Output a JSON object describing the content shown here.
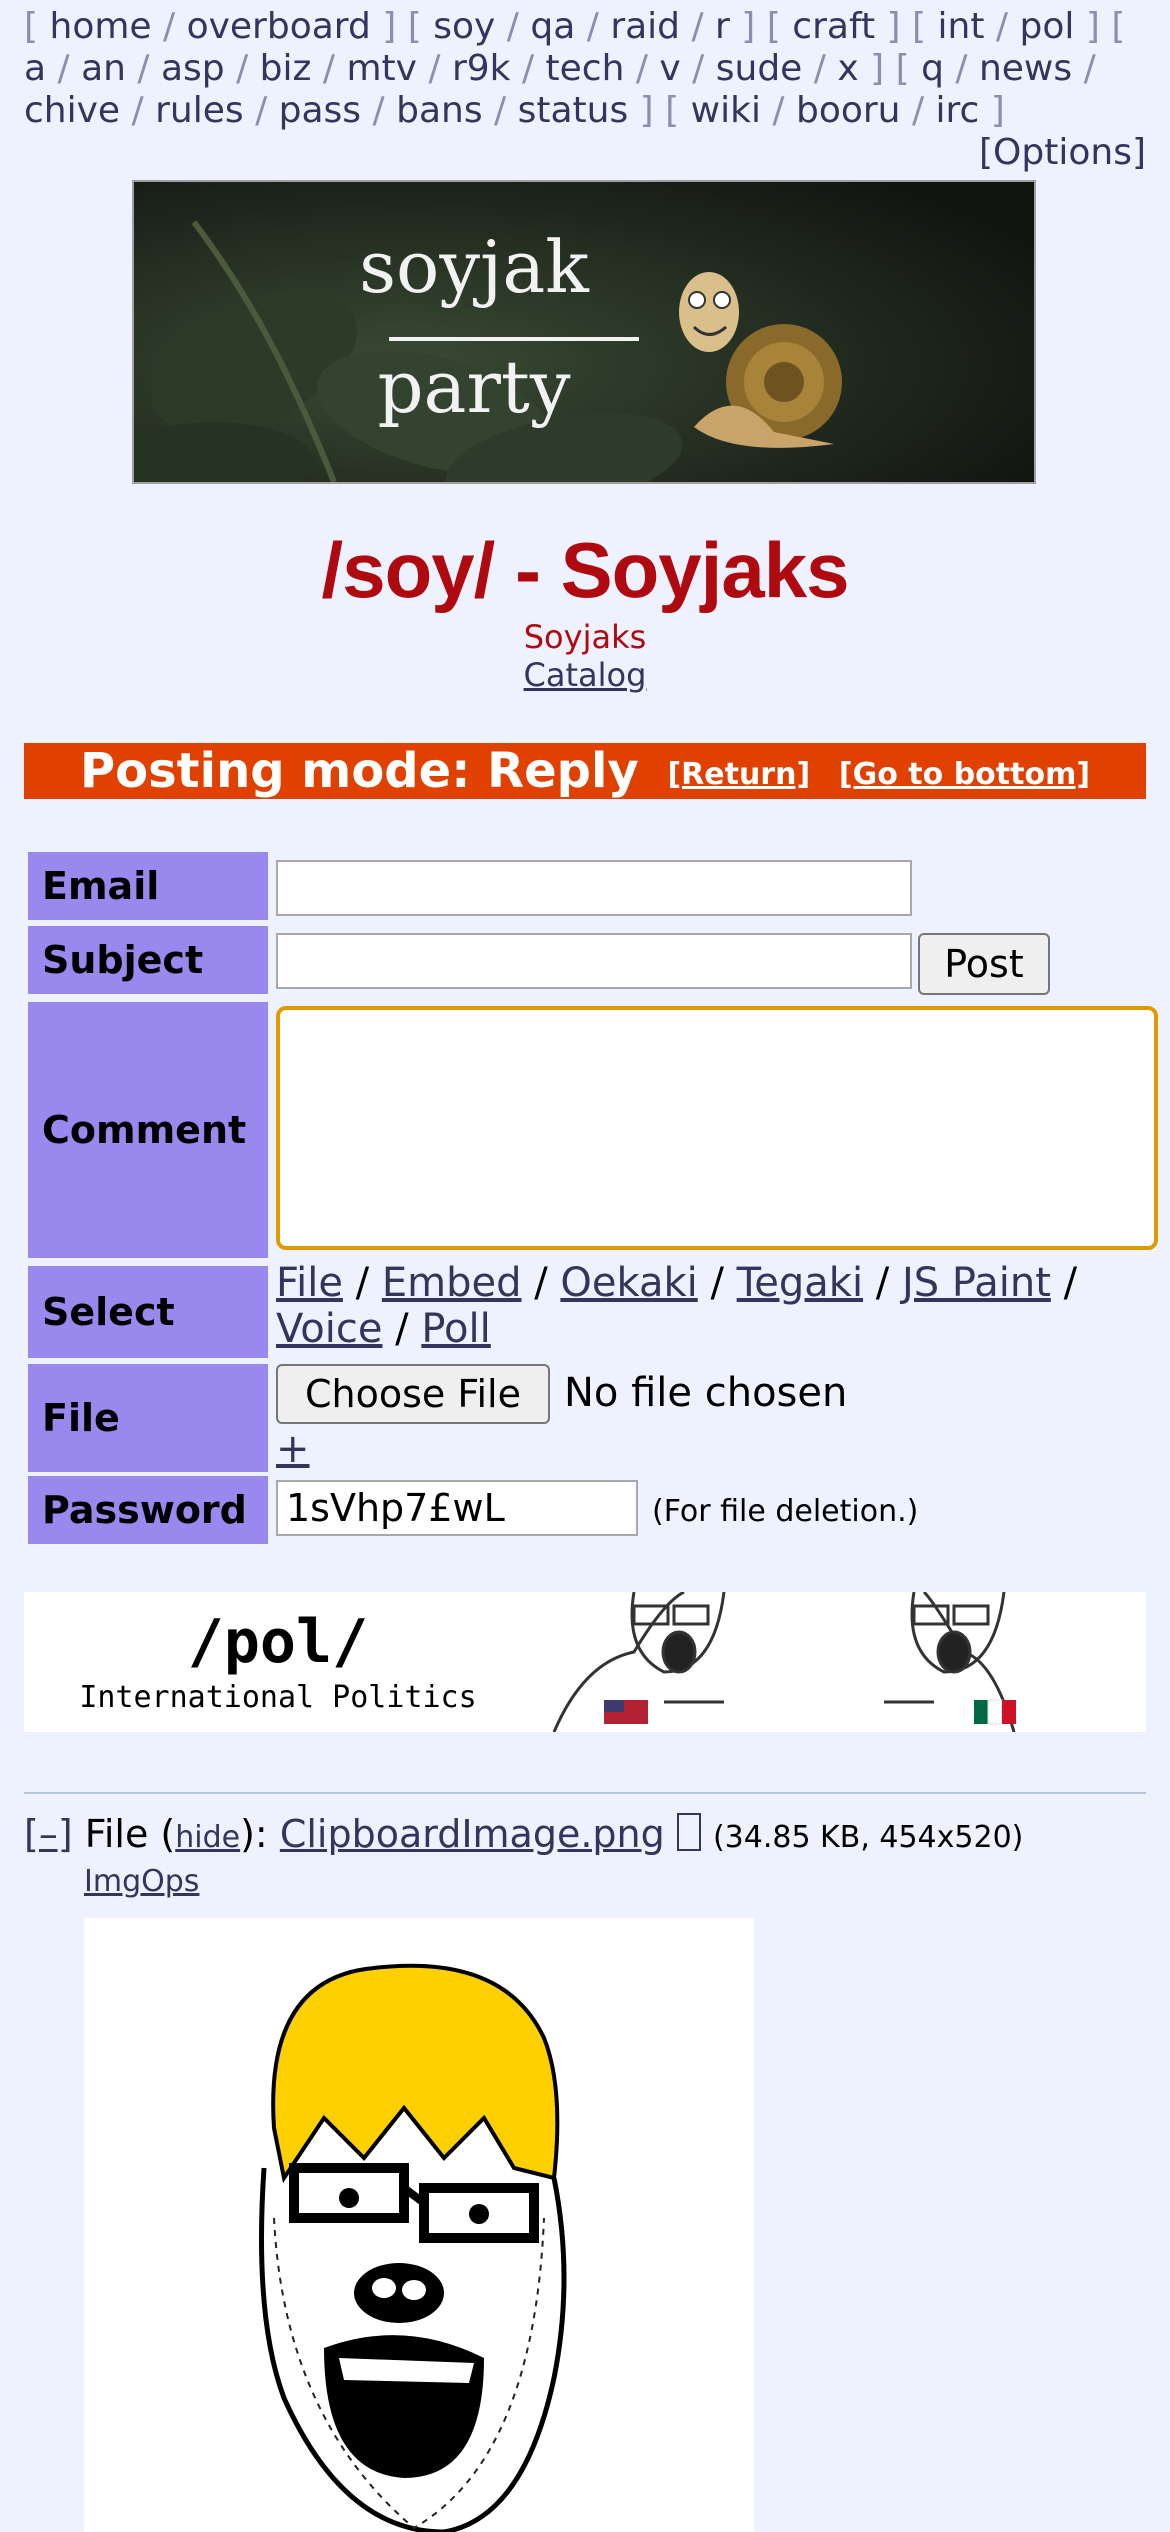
{
  "boardlist": [
    [
      "home",
      "overboard"
    ],
    [
      "soy",
      "qa",
      "raid",
      "r"
    ],
    [
      "craft"
    ],
    [
      "int",
      "pol"
    ],
    [
      "a",
      "an",
      "asp",
      "biz",
      "mtv",
      "r9k",
      "tech",
      "v",
      "sude",
      "x"
    ],
    [
      "q",
      "news",
      "chive",
      "rules",
      "pass",
      "bans",
      "status"
    ],
    [
      "wiki",
      "booru",
      "irc"
    ]
  ],
  "options_label": "[Options]",
  "banner": {
    "line1": "soyjak",
    "line2": "party"
  },
  "board": {
    "title": "/soy/ - Soyjaks",
    "subtitle": "Soyjaks",
    "catalog": "Catalog"
  },
  "mode": {
    "text": "Posting mode: Reply",
    "return_link": "[Return]",
    "bottom_link": "[Go to bottom]"
  },
  "form": {
    "email_label": "Email",
    "subject_label": "Subject",
    "post_button": "Post",
    "comment_label": "Comment",
    "select_label": "Select",
    "select_options": [
      "File",
      "Embed",
      "Oekaki",
      "Tegaki",
      "JS Paint",
      "Voice",
      "Poll"
    ],
    "file_label": "File",
    "choose_file": "Choose File",
    "no_file": "No file chosen",
    "add_file": "+",
    "password_label": "Password",
    "password_value": "1sVhp7£wL",
    "password_note": "(For file deletion.)"
  },
  "ad": {
    "title": "/pol/",
    "subtitle": "International Politics"
  },
  "post": {
    "collapse": "[–]",
    "file_prefix": "File (",
    "hide": "hide",
    "file_mid": "): ",
    "filename": "ClipboardImage.png",
    "meta": "(34.85 KB, 454x520)",
    "imgops": "ImgOps"
  },
  "colors": {
    "accent_red": "#af0a0f",
    "mode_bar": "#e04000",
    "label_bg": "#9988ee",
    "page_bg": "#eef2ff"
  }
}
